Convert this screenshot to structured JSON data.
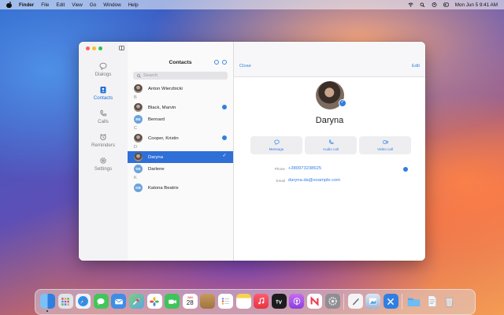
{
  "menubar": {
    "app_name": "Finder",
    "items": [
      "File",
      "Edit",
      "View",
      "Go",
      "Window",
      "Help"
    ],
    "datetime": "Mon Jun 5  9:41 AM"
  },
  "sidebar": {
    "items": [
      {
        "label": "Dialogs",
        "icon": "speech-bubble-icon"
      },
      {
        "label": "Contacts",
        "icon": "contacts-icon"
      },
      {
        "label": "Calls",
        "icon": "phone-icon"
      },
      {
        "label": "Reminders",
        "icon": "alarm-clock-icon"
      },
      {
        "label": "Settings",
        "icon": "gear-icon"
      }
    ],
    "active": "Contacts"
  },
  "contacts_list": {
    "title": "Contacts",
    "search_placeholder": "Search",
    "rows": [
      {
        "type": "contact",
        "name": "Anton Wierzbicki",
        "avatar": "photo",
        "initials": "",
        "verified": false
      },
      {
        "type": "section",
        "letter": "B"
      },
      {
        "type": "contact",
        "name": "Black, Marvin",
        "avatar": "photo",
        "initials": "",
        "verified": true
      },
      {
        "type": "contact",
        "name": "Bernard",
        "avatar": "initials",
        "initials": "BE",
        "verified": false
      },
      {
        "type": "section",
        "letter": "C"
      },
      {
        "type": "contact",
        "name": "Cooper, Kristin",
        "avatar": "photo",
        "initials": "",
        "verified": true
      },
      {
        "type": "section",
        "letter": "D"
      },
      {
        "type": "contact",
        "name": "Daryna",
        "avatar": "photo",
        "initials": "",
        "verified": true,
        "selected": true
      },
      {
        "type": "contact",
        "name": "Darlene",
        "avatar": "initials",
        "initials": "DE",
        "verified": false
      },
      {
        "type": "section",
        "letter": "K"
      },
      {
        "type": "contact",
        "name": "Katona Beatrix",
        "avatar": "initials",
        "initials": "KB",
        "verified": false
      }
    ]
  },
  "detail": {
    "close_label": "Close",
    "edit_label": "Edit",
    "name": "Daryna",
    "actions": [
      {
        "label": "Message",
        "icon": "message-icon"
      },
      {
        "label": "Audio call",
        "icon": "phone-icon"
      },
      {
        "label": "Video call",
        "icon": "video-icon"
      }
    ],
    "phone_label": "Phone",
    "phone_value": "+380973238625",
    "email_label": "Email",
    "email_value": "daryna.da@example.com"
  },
  "dock": {
    "calendar_month": "JUN",
    "calendar_day": "28",
    "apps": [
      "finder-icon",
      "launchpad-icon",
      "safari-icon",
      "messages-icon",
      "mail-icon",
      "maps-icon",
      "photos-icon",
      "facetime-icon",
      "calendar-icon",
      "notes-brown-icon",
      "reminders-icon",
      "notes-icon",
      "music-icon",
      "tv-icon",
      "podcasts-icon",
      "news-icon",
      "settings-icon",
      "pencil-app-icon",
      "preview-icon",
      "xcode-icon",
      "folder-icon",
      "document-icon",
      "trash-icon"
    ]
  }
}
